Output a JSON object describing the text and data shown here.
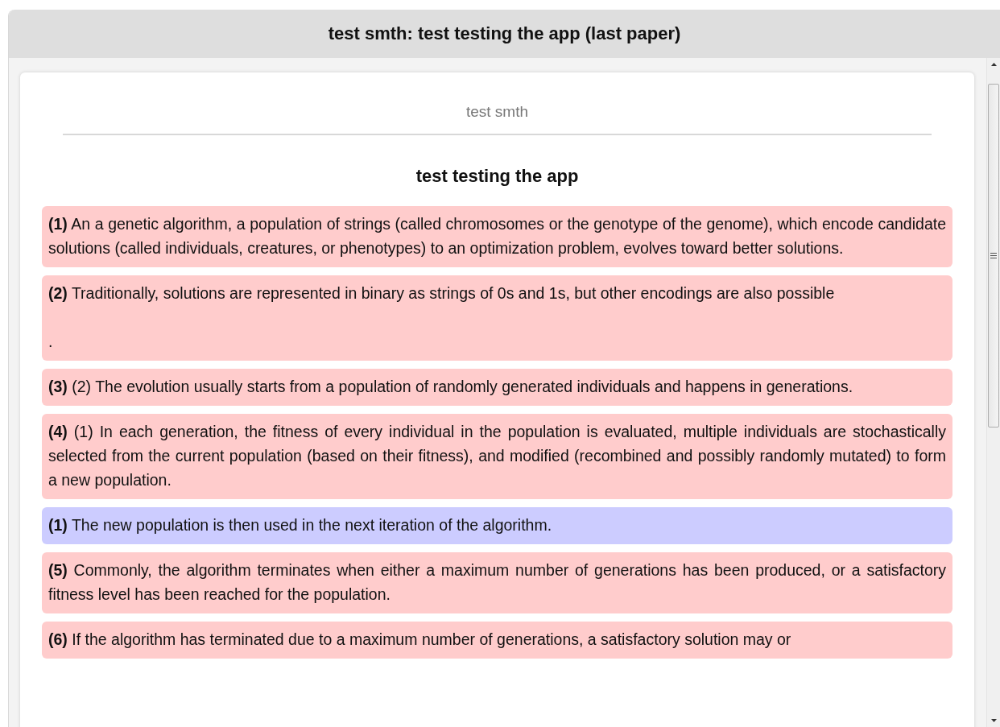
{
  "window": {
    "title": "test smth: test testing the app (last paper)"
  },
  "paper": {
    "subject": "test smth",
    "title": "test testing the app",
    "items": [
      {
        "color": "#ffcccc",
        "paragraphs": [
          "**(1)** An a genetic algorithm, a population of strings (called chromosomes or the genotype of the genome), which encode candidate solutions (called individuals, creatures, or phenotypes) to an optimization problem, evolves toward better solutions."
        ]
      },
      {
        "color": "#ffcccc",
        "paragraphs": [
          "**(2)** Traditionally, solutions are represented in binary as strings of 0s and 1s, but other encodings are also possible",
          "."
        ]
      },
      {
        "color": "#ffcccc",
        "paragraphs": [
          "**(3)** (2) The evolution usually starts from a population of randomly generated individuals and happens in generations."
        ]
      },
      {
        "color": "#ffcccc",
        "paragraphs": [
          "**(4)** (1) In each generation, the fitness of every individual in the population is evaluated, multiple individuals are stochastically selected from the current population (based on their fitness), and modified (recombined and possibly randomly mutated) to form a new population."
        ]
      },
      {
        "color": "#ccccff",
        "paragraphs": [
          "**(1)** The new population is then used in the next iteration of the algorithm."
        ]
      },
      {
        "color": "#ffcccc",
        "paragraphs": [
          "**(5)** Commonly, the algorithm terminates when either a maximum number of generations has been produced, or a satisfactory fitness level has been reached for the population."
        ]
      },
      {
        "color": "#ffcccc",
        "paragraphs": [
          "**(6)** If the algorithm has terminated due to a maximum number of generations, a satisfactory solution may or"
        ]
      }
    ]
  }
}
